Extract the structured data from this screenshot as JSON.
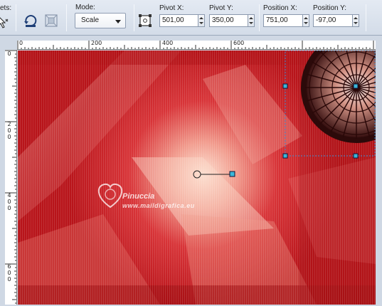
{
  "toolbar": {
    "presets_label": "ets:",
    "mode": {
      "label": "Mode:",
      "value": "Scale"
    },
    "pivot_x": {
      "label": "Pivot X:",
      "value": "501,00"
    },
    "pivot_y": {
      "label": "Pivot Y:",
      "value": "350,00"
    },
    "position_x": {
      "label": "Position X:",
      "value": "751,00"
    },
    "position_y": {
      "label": "Position Y:",
      "value": "-97,00"
    }
  },
  "ruler": {
    "horizontal_labels": [
      "0",
      "200",
      "400",
      "600"
    ],
    "vertical_labels": [
      [
        "0"
      ],
      [
        "2",
        "0",
        "0"
      ],
      [
        "4",
        "0",
        "0"
      ],
      [
        "6",
        "0",
        "0"
      ]
    ]
  },
  "watermark": {
    "name": "Pinuccia",
    "url": "www.maildigrafica.eu"
  },
  "icons": {
    "pick_tool": "pointer-arrow-icon",
    "reset_rotation": "reset-rotation-icon",
    "merge_layers": "layers-icon",
    "mode_dropdown": "chevron-down-icon",
    "pivot_center": "pivot-center-icon"
  }
}
